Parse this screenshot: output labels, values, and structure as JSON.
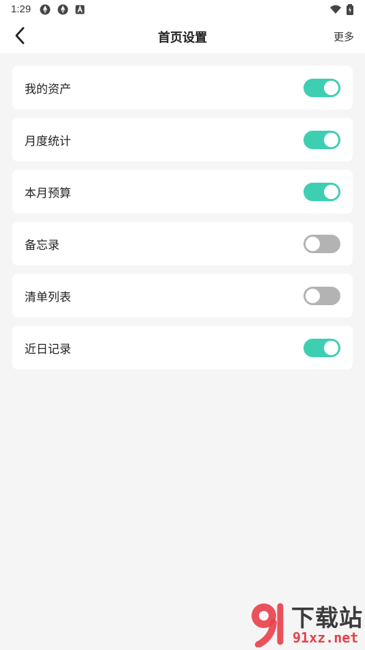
{
  "status_bar": {
    "time": "1:29",
    "left_icons": [
      "aperture-icon",
      "aperture-icon",
      "font-a-icon"
    ],
    "right_icons": [
      "wifi-icon",
      "battery-icon"
    ]
  },
  "header": {
    "title": "首页设置",
    "more_label": "更多",
    "back_icon": "chevron-left-icon"
  },
  "settings": [
    {
      "label": "我的资产",
      "enabled": true
    },
    {
      "label": "月度统计",
      "enabled": true
    },
    {
      "label": "本月预算",
      "enabled": true
    },
    {
      "label": "备忘录",
      "enabled": false
    },
    {
      "label": "清单列表",
      "enabled": false
    },
    {
      "label": "近日记录",
      "enabled": true
    }
  ],
  "watermark": {
    "top_text": "下载站",
    "bottom_text": "91xz.net",
    "logo_text": "91"
  },
  "colors": {
    "toggle_on": "#3ecfb2",
    "toggle_off": "#b3b3b3",
    "background": "#f5f5f5",
    "watermark_red": "#e8404a"
  }
}
